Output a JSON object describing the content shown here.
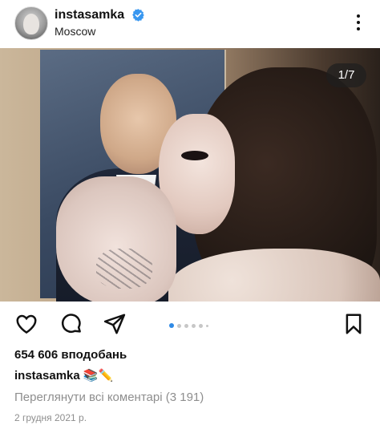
{
  "header": {
    "username": "instasamka",
    "location": "Moscow",
    "verified": true
  },
  "photo": {
    "slide_counter": "1/7",
    "current_slide": 1,
    "total_slides": 7
  },
  "actions": {
    "icons": [
      "heart-icon",
      "comment-icon",
      "share-icon",
      "bookmark-icon"
    ]
  },
  "post": {
    "likes": "654 606 вподобань",
    "caption_user": "instasamka",
    "caption_emoji": "📚✏️",
    "view_comments": "Переглянути всі коментарі (3 191)",
    "date": "2 грудня 2021 р."
  },
  "colors": {
    "verified_badge": "#3897f0",
    "active_dot": "#2f8ae5",
    "secondary_text": "#8e8e8e"
  }
}
